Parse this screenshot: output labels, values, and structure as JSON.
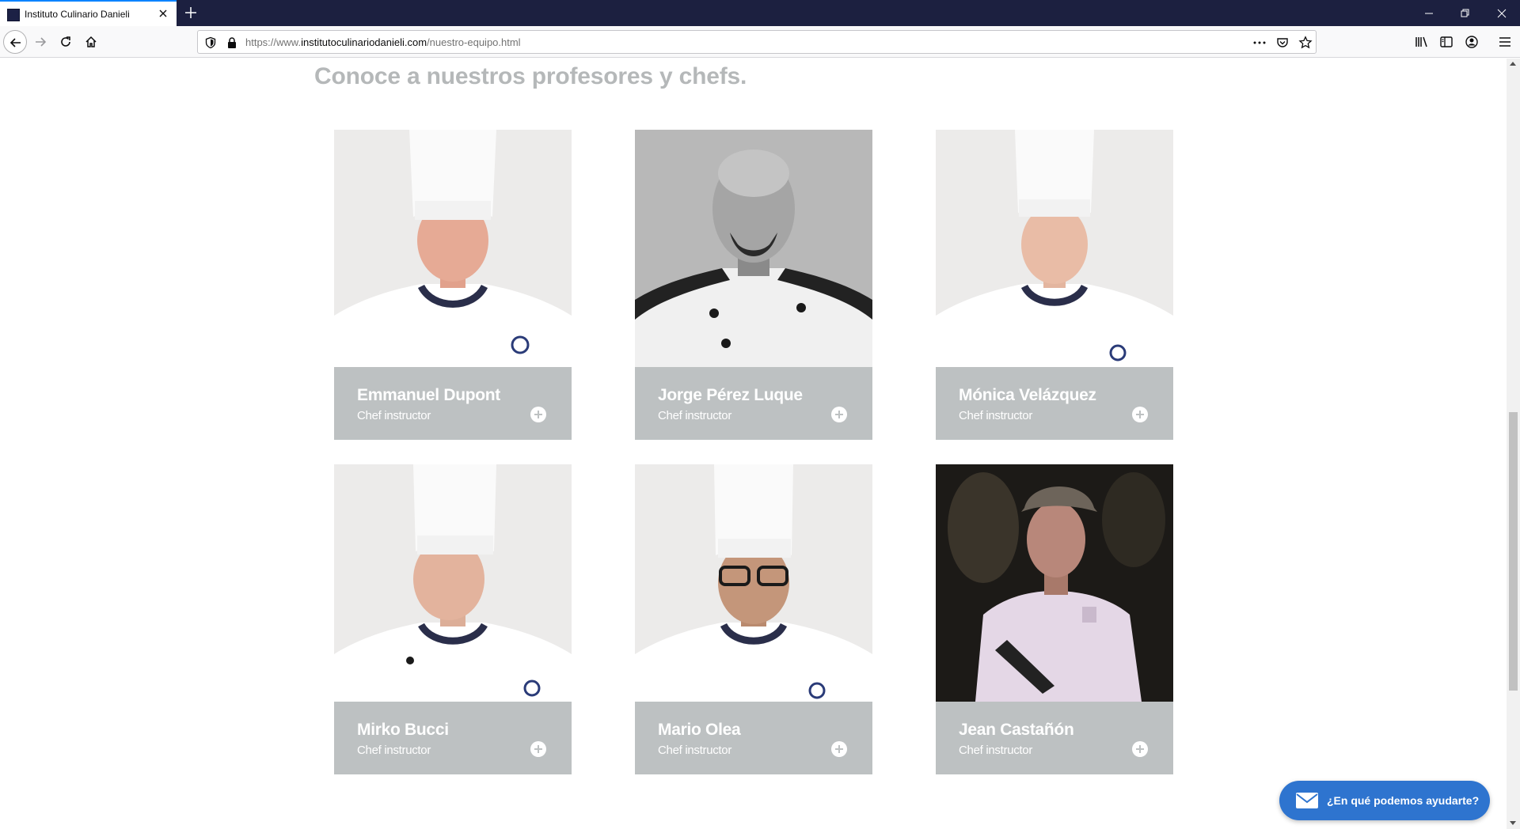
{
  "browser": {
    "tab_title": "Instituto Culinario Danieli",
    "url_prefix": "https://www.",
    "url_domain": "institutoculinariodanieli.com",
    "url_path": "/nuestro-equipo.html"
  },
  "page": {
    "heading": "Conoce a nuestros profesores y chefs."
  },
  "team": [
    {
      "name": "Emmanuel Dupont",
      "role": "Chef instructor"
    },
    {
      "name": "Jorge Pérez Luque",
      "role": "Chef instructor"
    },
    {
      "name": "Mónica Velázquez",
      "role": "Chef instructor"
    },
    {
      "name": "Mirko Bucci",
      "role": "Chef instructor"
    },
    {
      "name": "Mario Olea",
      "role": "Chef instructor"
    },
    {
      "name": "Jean Castañón",
      "role": "Chef instructor"
    }
  ],
  "help_widget": {
    "label": "¿En qué podemos ayudarte?"
  },
  "icons": {
    "tab": [
      "favicon",
      "close-icon",
      "plus-icon"
    ],
    "window": [
      "minimize-icon",
      "restore-icon",
      "close-window-icon"
    ],
    "nav": [
      "back-arrow-icon",
      "forward-arrow-icon",
      "reload-icon",
      "home-icon",
      "shield-icon",
      "lock-icon",
      "more-icon",
      "pocket-icon",
      "star-icon",
      "library-icon",
      "sidebar-icon",
      "account-icon",
      "menu-icon"
    ],
    "card": "plus-circle-icon",
    "help": "mail-icon"
  },
  "colors": {
    "titlebar": "#1c2040",
    "card_band": "#bdc1c2",
    "heading": "#b5b8b9",
    "help_button": "#2e74cf"
  }
}
